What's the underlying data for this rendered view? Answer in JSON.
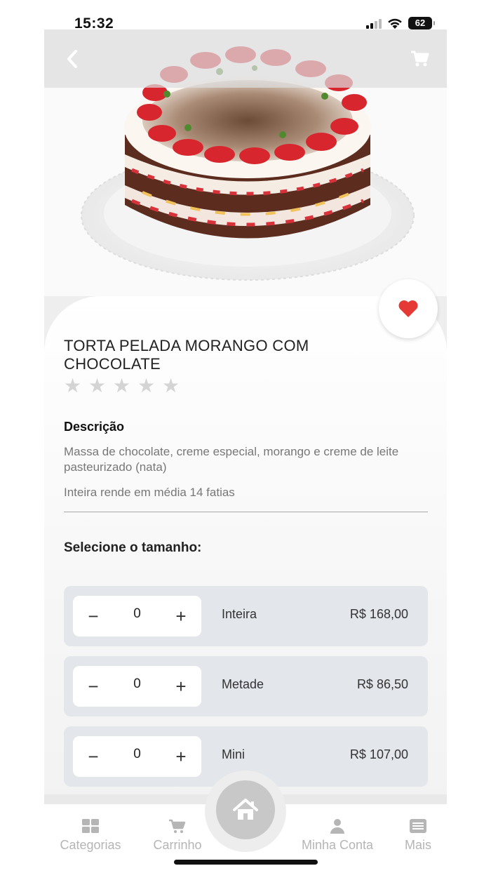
{
  "status_bar": {
    "time": "15:32",
    "battery": "62"
  },
  "header": {
    "back_icon": "chevron-left-icon",
    "cart_icon": "cart-icon"
  },
  "product": {
    "title": "TORTA PELADA MORANGO COM CHOCOLATE",
    "rating": 0,
    "rating_max": 5,
    "favorite_icon": "heart-icon",
    "favorite_color": "#e53935"
  },
  "description": {
    "heading": "Descrição",
    "text": "Massa de chocolate, creme especial, morango e creme de leite pasteurizado (nata)",
    "yield": "Inteira rende em média 14 fatias"
  },
  "sizes": {
    "heading": "Selecione o tamanho:",
    "options": [
      {
        "name": "Inteira",
        "price": "R$ 168,00",
        "quantity": "0"
      },
      {
        "name": "Metade",
        "price": "R$ 86,50",
        "quantity": "0"
      },
      {
        "name": "Mini",
        "price": "R$ 107,00",
        "quantity": "0"
      }
    ],
    "minus_symbol": "−",
    "plus_symbol": "+"
  },
  "bottom_nav": {
    "items": [
      {
        "label": "Categorias",
        "icon": "grid-icon"
      },
      {
        "label": "Carrinho",
        "icon": "cart-icon"
      },
      {
        "label": "Minha Conta",
        "icon": "user-icon"
      },
      {
        "label": "Mais",
        "icon": "list-icon"
      }
    ],
    "home_icon": "home-icon"
  },
  "colors": {
    "accent": "#e53935",
    "option_bg": "#e3e6ea",
    "nav_text": "#b5b5b5"
  }
}
